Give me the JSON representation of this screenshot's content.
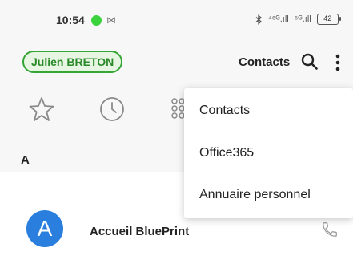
{
  "status_bar": {
    "time": "10:54",
    "message_glyph": "⋈",
    "signal_1": "⁴⁶ᴳ.ıll",
    "signal_2": "⁵ᴳ.ıll",
    "battery": "42"
  },
  "header": {
    "user_name": "Julien BRETON",
    "title": "Contacts"
  },
  "tabs": [
    {
      "icon": "star-icon"
    },
    {
      "icon": "clock-icon"
    },
    {
      "icon": "keypad-icon"
    }
  ],
  "section": {
    "letter": "A"
  },
  "contacts": [
    {
      "initial": "A",
      "name": "Accueil BluePrint",
      "avatar_color": "#2a7fde"
    }
  ],
  "menu": {
    "items": [
      {
        "label": "Contacts"
      },
      {
        "label": "Office365"
      },
      {
        "label": "Annuaire personnel"
      }
    ]
  },
  "colors": {
    "accent_green": "#35a535",
    "avatar_blue": "#2a7fde",
    "status_dot": "#3bd33b"
  }
}
